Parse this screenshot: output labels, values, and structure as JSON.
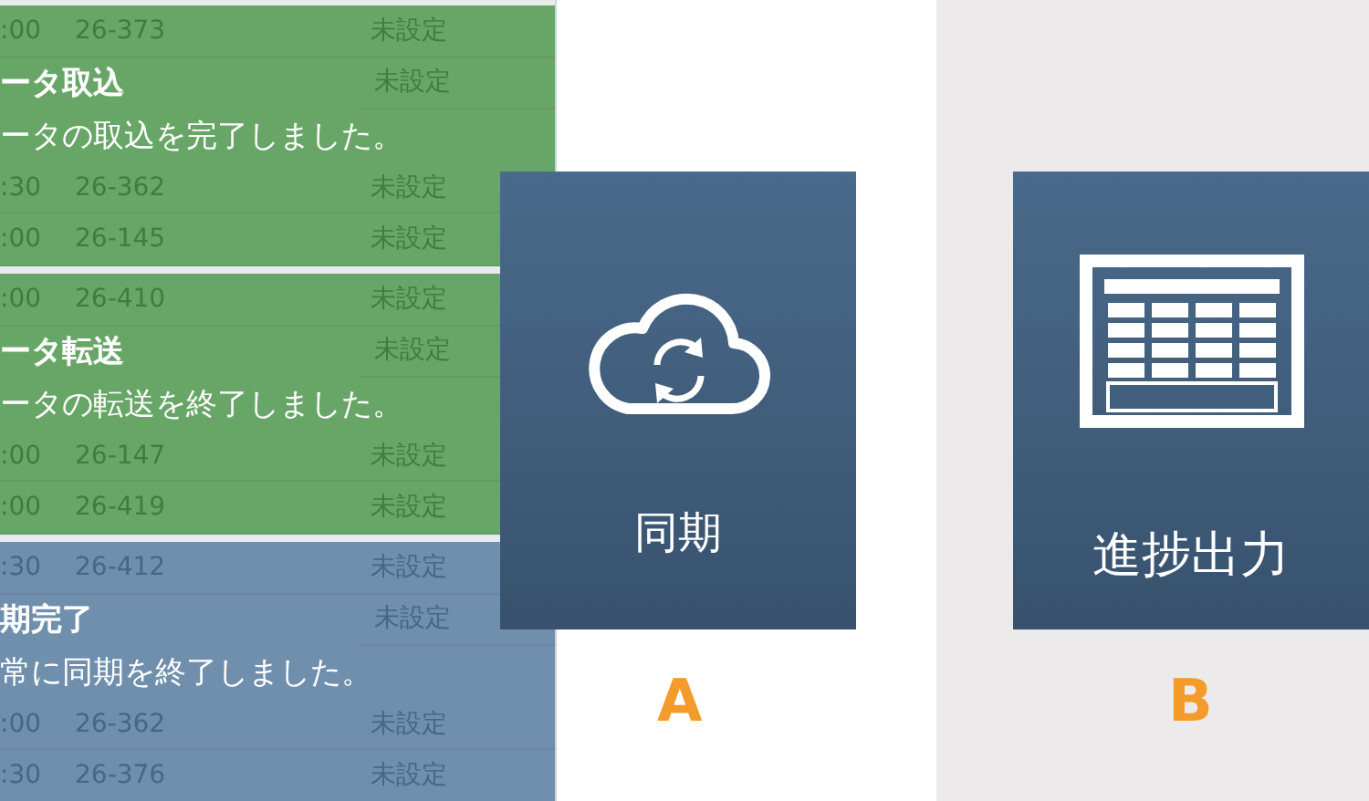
{
  "notifications": [
    {
      "kind": "success",
      "title": "ータ取込",
      "message": "ータの取込を完了しました。",
      "rows": [
        {
          "time": ":00",
          "id": "26-373",
          "status": "未設定"
        },
        {
          "status": "未設定"
        },
        {
          "time": ":30",
          "id": "26-362",
          "status": "未設定"
        },
        {
          "time": ":00",
          "id": "26-145",
          "status": "未設定"
        }
      ]
    },
    {
      "kind": "success",
      "title": "ータ転送",
      "message": "ータの転送を終了しました。",
      "rows": [
        {
          "time": ":00",
          "id": "26-410",
          "status": "未設定"
        },
        {
          "status": "未設定"
        },
        {
          "time": ":00",
          "id": "26-147",
          "status": "未設定"
        },
        {
          "time": ":00",
          "id": "26-419",
          "status": "未設定"
        }
      ]
    },
    {
      "kind": "info",
      "title": "期完了",
      "message": "常に同期を終了しました。",
      "rows": [
        {
          "time": ":30",
          "id": "26-412",
          "status": "未設定"
        },
        {
          "status": "未設定"
        },
        {
          "time": ":00",
          "id": "26-362",
          "status": "未設定"
        },
        {
          "time": ":30",
          "id": "26-376",
          "status": "未設定"
        }
      ]
    }
  ],
  "tiles": [
    {
      "kind": "sync",
      "label": "同期",
      "marker": "A"
    },
    {
      "kind": "report",
      "label": "進捗出力",
      "marker": "B"
    }
  ]
}
